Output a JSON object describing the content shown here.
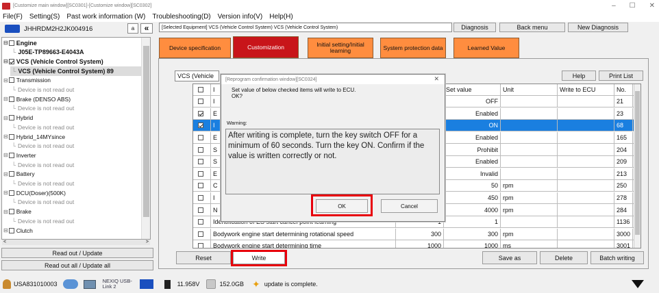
{
  "window": {
    "title": "[Customize main window][SC0301]-[Customize window][SC0302]",
    "minimize": "–",
    "maximize": "☐",
    "close": "✕"
  },
  "menu": [
    "File(F)",
    "Setting(S)",
    "Past work information (W)",
    "Troubleshooting(D)",
    "Version info(V)",
    "Help(H)"
  ],
  "vin": "JHHRDM2H2JK004916",
  "selected_equipment": "[Selected Equipment] VCS (Vehicle Control System) VCS (Vehicle Control System)",
  "top_buttons": {
    "diagnosis": "Diagnosis",
    "back_menu": "Back menu",
    "new_diagnosis": "New Diagnosis"
  },
  "tabs": [
    "Device specification",
    "Customization",
    "Initial setting/Initial learning",
    "System protection data",
    "Learned Value"
  ],
  "tree": [
    {
      "label": "Engine",
      "type": "b",
      "checked": false
    },
    {
      "label": "J05E-TP89663-E4043A",
      "type": "bsub"
    },
    {
      "label": "VCS (Vehicle Control System)",
      "type": "b",
      "checked": true
    },
    {
      "label": "VCS (Vehicle Control System) 89",
      "type": "bsub"
    },
    {
      "label": "Transmission",
      "checked": false
    },
    {
      "label": "Device is not read out",
      "type": "sub"
    },
    {
      "label": "Brake (DENSO ABS)",
      "checked": false
    },
    {
      "label": "Device is not read out",
      "type": "sub"
    },
    {
      "label": "Hybrid",
      "checked": false
    },
    {
      "label": "Device is not read out",
      "type": "sub"
    },
    {
      "label": "Hybrid_14MYsince",
      "checked": false
    },
    {
      "label": "Device is not read out",
      "type": "sub"
    },
    {
      "label": "Inverter",
      "checked": false
    },
    {
      "label": "Device is not read out",
      "type": "sub"
    },
    {
      "label": "Battery",
      "checked": false
    },
    {
      "label": "Device is not read out",
      "type": "sub"
    },
    {
      "label": "DCU(Doser)(500K)",
      "checked": false
    },
    {
      "label": "Device is not read out",
      "type": "sub"
    },
    {
      "label": "Brake",
      "checked": false
    },
    {
      "label": "Device is not read out",
      "type": "sub"
    },
    {
      "label": "Clutch",
      "checked": false
    }
  ],
  "left_buttons": {
    "read_out": "Read out / Update",
    "read_all": "Read out all / Update all"
  },
  "vcs_label": "VCS (Vehicle",
  "help": "Help",
  "print_list": "Print List",
  "columns": {
    "set_value": "Set value",
    "unit": "Unit",
    "write": "Write to ECU",
    "no": "No."
  },
  "rows": [
    {
      "checked": false,
      "item": "I",
      "cur": "",
      "set": "OFF",
      "unit": "",
      "no": "21"
    },
    {
      "checked": true,
      "item": "E",
      "cur": "",
      "set": "Enabled",
      "unit": "",
      "no": "23"
    },
    {
      "checked": true,
      "item": "I",
      "cur": "",
      "set": "ON",
      "unit": "",
      "no": "68",
      "sel": true
    },
    {
      "checked": false,
      "item": "E",
      "cur": "",
      "set": "Enabled",
      "unit": "",
      "no": "165"
    },
    {
      "checked": false,
      "item": "S",
      "cur": "",
      "set": "Prohibit",
      "unit": "",
      "no": "204"
    },
    {
      "checked": false,
      "item": "S",
      "cur": "",
      "set": "Enabled",
      "unit": "",
      "no": "209"
    },
    {
      "checked": false,
      "item": "E",
      "cur": "",
      "set": "Invalid",
      "unit": "",
      "no": "213"
    },
    {
      "checked": false,
      "item": "C",
      "cur": "",
      "set": "50",
      "unit": "rpm",
      "no": "250"
    },
    {
      "checked": false,
      "item": "I",
      "cur": "",
      "set": "450",
      "unit": "rpm",
      "no": "278"
    },
    {
      "checked": false,
      "item": "N",
      "cur": "",
      "set": "4000",
      "unit": "rpm",
      "no": "284"
    },
    {
      "checked": false,
      "item": "Identification of ES start cancel  point learning",
      "cur": "1",
      "set": "1",
      "unit": "",
      "no": "1136"
    },
    {
      "checked": false,
      "item": "Bodywork engine start determining rotational speed",
      "cur": "300",
      "set": "300",
      "unit": "rpm",
      "no": "3000"
    },
    {
      "checked": false,
      "item": "Bodywork engine start determining time",
      "cur": "1000",
      "set": "1000",
      "unit": "ms",
      "no": "3001"
    }
  ],
  "bottom_buttons": {
    "reset": "Reset",
    "write": "Write",
    "save_as": "Save as",
    "delete": "Delete",
    "batch": "Batch writing"
  },
  "dialog": {
    "title": "[Reprogram confirmation window][SC0324]",
    "close": "✕",
    "message": "Set value of below checked items will write to ECU.\nOK?",
    "warning_label": "Warning:",
    "warning_text": "After writing is complete, turn the key switch OFF for a minimum of 60 seconds.  Turn the key ON. Confirm if the value is written correctly or not.",
    "ok": "OK",
    "cancel": "Cancel"
  },
  "status": {
    "device_id": "USA831010003",
    "nexiq": "NEXIQ USB-Link 2",
    "voltage": "11.958V",
    "disk": "152.0GB",
    "message": "update is complete."
  }
}
